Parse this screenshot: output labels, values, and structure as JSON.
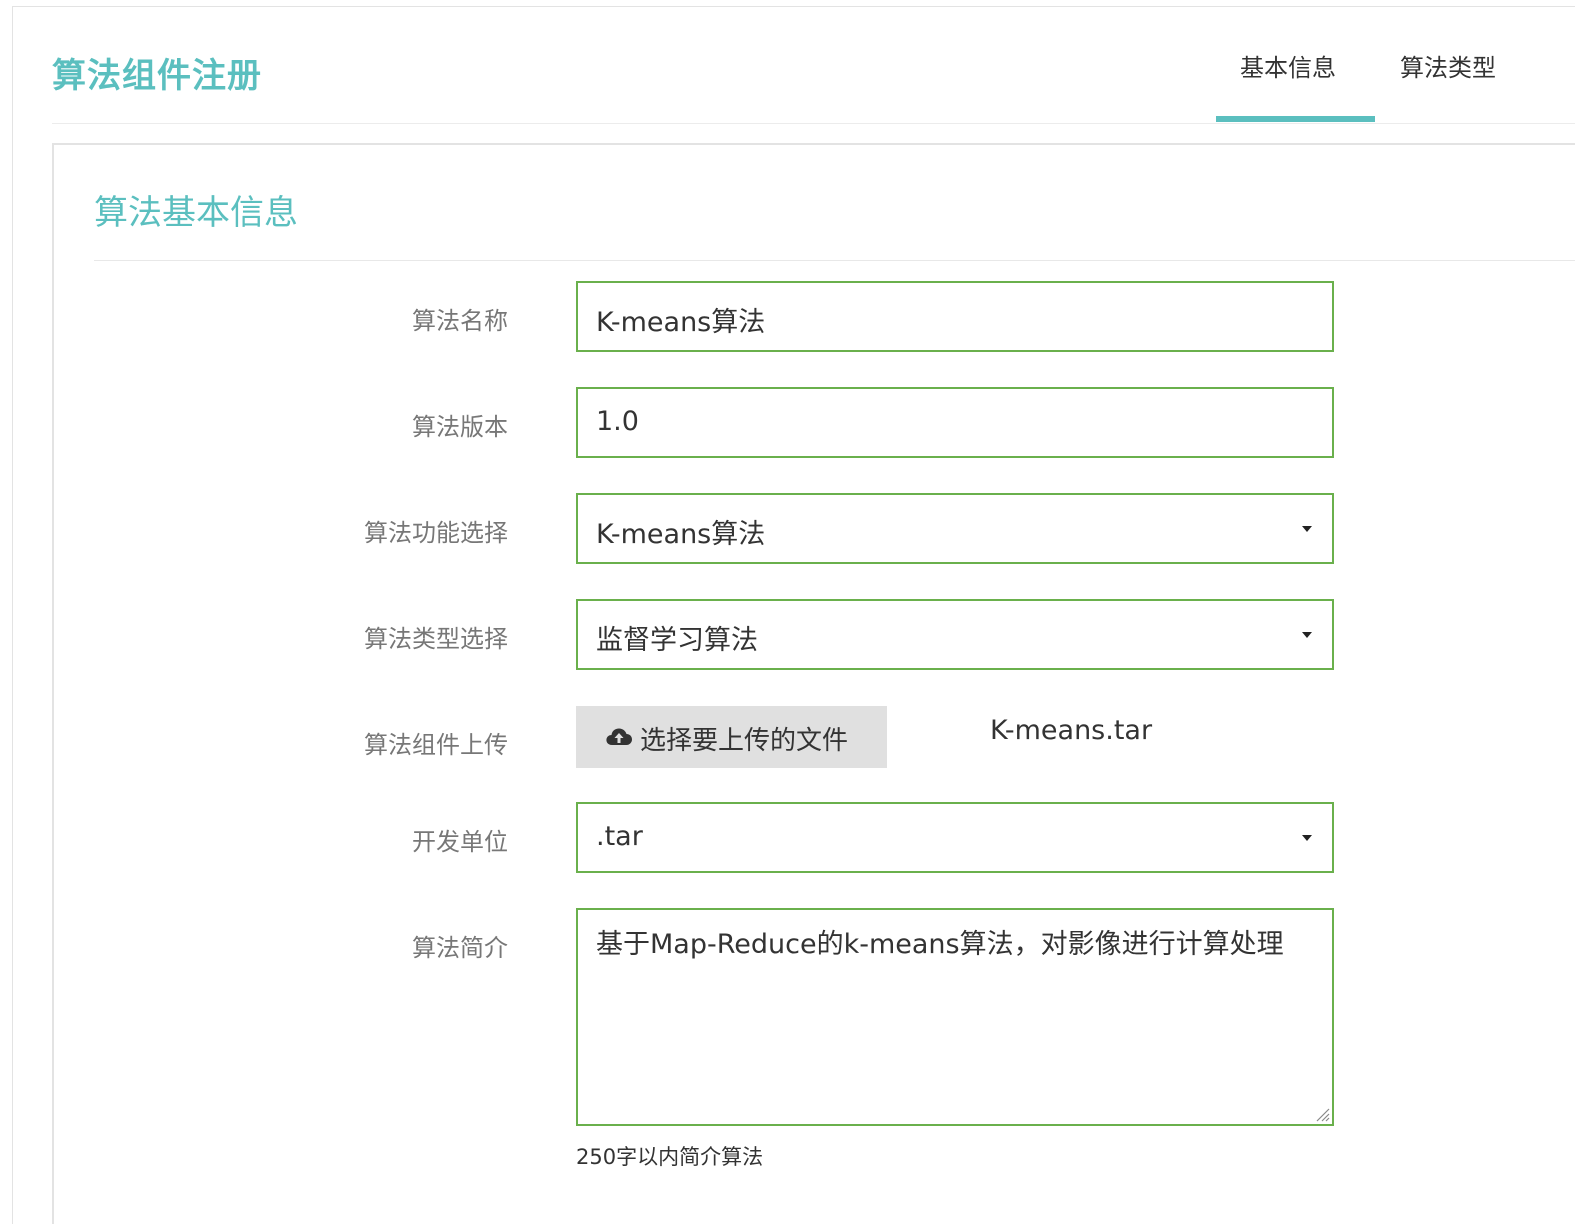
{
  "header": {
    "title": "算法组件注册",
    "tabs": [
      {
        "label": "基本信息",
        "active": true
      },
      {
        "label": "算法类型",
        "active": false
      }
    ],
    "accent_color": "#5bbfbf"
  },
  "section": {
    "title": "算法基本信息"
  },
  "form": {
    "name": {
      "label": "算法名称",
      "value": "K-means算法"
    },
    "version": {
      "label": "算法版本",
      "value": "1.0"
    },
    "function": {
      "label": "算法功能选择",
      "value": "K-means算法"
    },
    "type": {
      "label": "算法类型选择",
      "value": "监督学习算法"
    },
    "upload": {
      "label": "算法组件上传",
      "button_label": "选择要上传的文件",
      "file_name": "K-means.tar"
    },
    "unit": {
      "label": "开发单位",
      "value": ".tar"
    },
    "description": {
      "label": "算法简介",
      "value": "基于Map-Reduce的k-means算法，对影像进行计算处理",
      "help": "250字以内简介算法"
    },
    "border_color": "#6ab04c"
  },
  "icons": {
    "upload": "cloud-upload-icon",
    "dropdown": "caret-down-icon"
  }
}
